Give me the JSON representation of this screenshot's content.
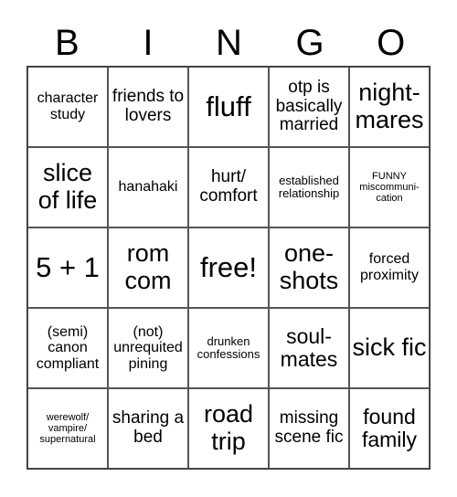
{
  "header": [
    "B",
    "I",
    "N",
    "G",
    "O"
  ],
  "cells": [
    {
      "text": "character study",
      "size": "s3"
    },
    {
      "text": "friends to lovers",
      "size": "s4"
    },
    {
      "text": "fluff",
      "size": "s7"
    },
    {
      "text": "otp is basically married",
      "size": "s4"
    },
    {
      "text": "night-mares",
      "size": "s6"
    },
    {
      "text": "slice of life",
      "size": "s6"
    },
    {
      "text": "hanahaki",
      "size": "s3"
    },
    {
      "text": "hurt/ comfort",
      "size": "s4"
    },
    {
      "text": "established relationship",
      "size": "s2"
    },
    {
      "text": "FUNNY miscommuni-cation",
      "size": "s1"
    },
    {
      "text": "5 + 1",
      "size": "s7"
    },
    {
      "text": "rom com",
      "size": "s6"
    },
    {
      "text": "free!",
      "size": "s7"
    },
    {
      "text": "one-shots",
      "size": "s6"
    },
    {
      "text": "forced proximity",
      "size": "s3"
    },
    {
      "text": "(semi) canon compliant",
      "size": "s3"
    },
    {
      "text": "(not) unrequited pining",
      "size": "s3"
    },
    {
      "text": "drunken confessions",
      "size": "s2"
    },
    {
      "text": "soul-mates",
      "size": "s5"
    },
    {
      "text": "sick fic",
      "size": "s6"
    },
    {
      "text": "werewolf/ vampire/ supernatural",
      "size": "s1"
    },
    {
      "text": "sharing a bed",
      "size": "s4"
    },
    {
      "text": "road trip",
      "size": "s6"
    },
    {
      "text": "missing scene fic",
      "size": "s4"
    },
    {
      "text": "found family",
      "size": "s5"
    }
  ]
}
